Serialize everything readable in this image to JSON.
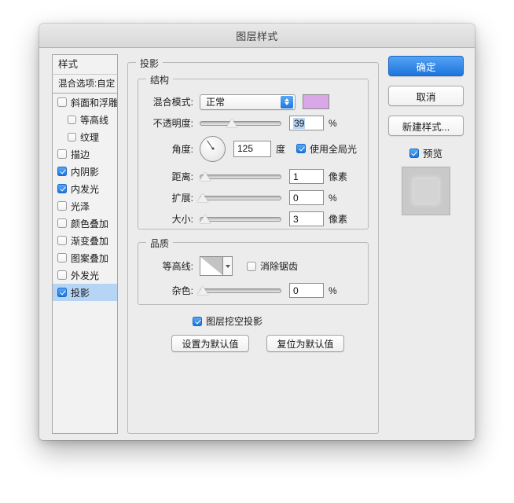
{
  "window": {
    "title": "图层样式"
  },
  "sidebar": {
    "header": "样式",
    "blending_options": "混合选项:自定",
    "items": [
      {
        "label": "斜面和浮雕",
        "checked": false,
        "indent": false,
        "selected": false
      },
      {
        "label": "等高线",
        "checked": false,
        "indent": true,
        "selected": false
      },
      {
        "label": "纹理",
        "checked": false,
        "indent": true,
        "selected": false
      },
      {
        "label": "描边",
        "checked": false,
        "indent": false,
        "selected": false
      },
      {
        "label": "内阴影",
        "checked": true,
        "indent": false,
        "selected": false
      },
      {
        "label": "内发光",
        "checked": true,
        "indent": false,
        "selected": false
      },
      {
        "label": "光泽",
        "checked": false,
        "indent": false,
        "selected": false
      },
      {
        "label": "颜色叠加",
        "checked": false,
        "indent": false,
        "selected": false
      },
      {
        "label": "渐变叠加",
        "checked": false,
        "indent": false,
        "selected": false
      },
      {
        "label": "图案叠加",
        "checked": false,
        "indent": false,
        "selected": false
      },
      {
        "label": "外发光",
        "checked": false,
        "indent": false,
        "selected": false
      },
      {
        "label": "投影",
        "checked": true,
        "indent": false,
        "selected": true
      }
    ]
  },
  "panel": {
    "group_title": "投影",
    "structure": {
      "legend": "结构",
      "blend_mode_label": "混合模式:",
      "blend_mode_value": "正常",
      "color_swatch": "#D9A8E8",
      "opacity_label": "不透明度:",
      "opacity_value": "39",
      "opacity_unit": "%",
      "opacity_percent": 39,
      "angle_label": "角度:",
      "angle_value": "125",
      "angle_unit": "度",
      "angle_degrees": 125,
      "global_light_label": "使用全局光",
      "global_light_checked": true,
      "distance_label": "距离:",
      "distance_value": "1",
      "distance_unit": "像素",
      "distance_percent": 3,
      "spread_label": "扩展:",
      "spread_value": "0",
      "spread_unit": "%",
      "spread_percent": 0,
      "size_label": "大小:",
      "size_value": "3",
      "size_unit": "像素",
      "size_percent": 3
    },
    "quality": {
      "legend": "品质",
      "contour_label": "等高线:",
      "antialias_label": "消除锯齿",
      "antialias_checked": false,
      "noise_label": "杂色:",
      "noise_value": "0",
      "noise_unit": "%",
      "noise_percent": 0
    },
    "knockout_label": "图层挖空投影",
    "knockout_checked": true,
    "set_default_button": "设置为默认值",
    "reset_default_button": "复位为默认值"
  },
  "actions": {
    "ok": "确定",
    "cancel": "取消",
    "new_style": "新建样式...",
    "preview_label": "预览",
    "preview_checked": true
  }
}
